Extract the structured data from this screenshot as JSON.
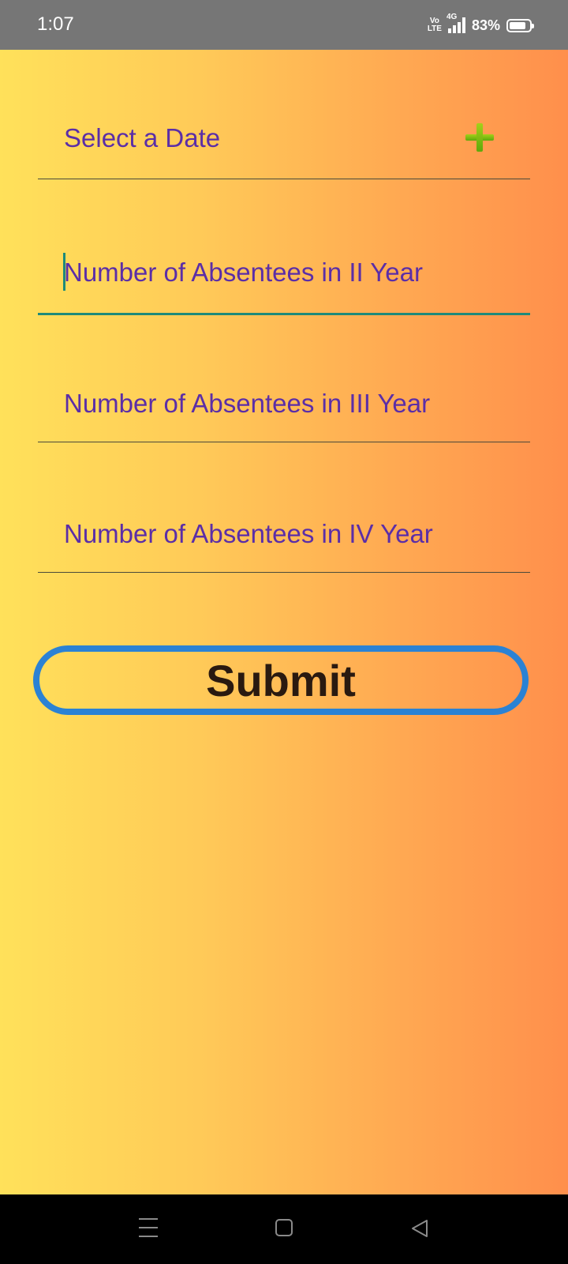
{
  "status_bar": {
    "time": "1:07",
    "volte_top": "Vo",
    "volte_bottom": "LTE",
    "network": "4G",
    "battery_percent_label": "83%",
    "battery_level": 0.83
  },
  "form": {
    "date_label": "Select a Date",
    "absentees_ii_placeholder": "Number of Absentees in II Year",
    "absentees_iii_placeholder": "Number of Absentees in III Year",
    "absentees_iv_placeholder": "Number of Absentees in IV Year",
    "submit_label": "Submit"
  },
  "colors": {
    "gradient_start": "#ffe15a",
    "gradient_end": "#ff8f4c",
    "label_text": "#5b2ea7",
    "focus_accent": "#1e8a7a",
    "button_border": "#2b82d4",
    "add_icon": "#7cc014"
  },
  "icons": {
    "add": "plus-icon",
    "nav_menu": "menu-icon",
    "nav_home": "home-icon",
    "nav_back": "back-icon"
  }
}
